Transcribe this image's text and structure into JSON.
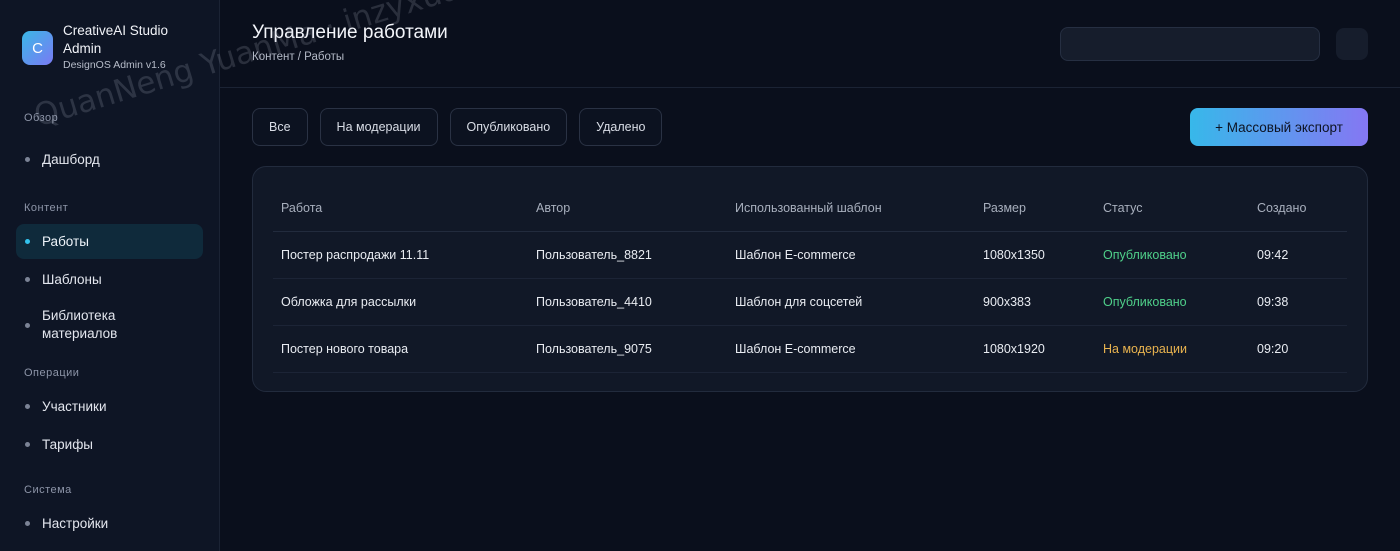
{
  "brand": {
    "logo_letter": "C",
    "name": "CreativeAI Studio Admin",
    "version": "DesignOS Admin v1.6"
  },
  "sidebar": {
    "sections": [
      {
        "title": "Обзор",
        "items": [
          {
            "label": "Дашборд",
            "active": false
          }
        ]
      },
      {
        "title": "Контент",
        "items": [
          {
            "label": "Работы",
            "active": true
          },
          {
            "label": "Шаблоны",
            "active": false
          },
          {
            "label": "Библиотека материалов",
            "active": false
          }
        ]
      },
      {
        "title": "Операции",
        "items": [
          {
            "label": "Участники",
            "active": false
          },
          {
            "label": "Тарифы",
            "active": false
          }
        ]
      },
      {
        "title": "Система",
        "items": [
          {
            "label": "Настройки",
            "active": false
          }
        ]
      }
    ]
  },
  "header": {
    "title": "Управление работами",
    "breadcrumb": "Контент / Работы",
    "search_value": "",
    "search_placeholder": ""
  },
  "filters": [
    "Все",
    "На модерации",
    "Опубликовано",
    "Удалено"
  ],
  "actions": {
    "export_label": "+ Массовый экспорт"
  },
  "table": {
    "columns": [
      "Работа",
      "Автор",
      "Использованный шаблон",
      "Размер",
      "Статус",
      "Создано"
    ],
    "rows": [
      {
        "work": "Постер распродажи 11.11",
        "author": "Пользователь_8821",
        "template": "Шаблон E-commerce",
        "size": "1080x1350",
        "status": "Опубликовано",
        "status_kind": "published",
        "created": "09:42"
      },
      {
        "work": "Обложка для рассылки",
        "author": "Пользователь_4410",
        "template": "Шаблон для соцсетей",
        "size": "900x383",
        "status": "Опубликовано",
        "status_kind": "published",
        "created": "09:38"
      },
      {
        "work": "Постер нового товара",
        "author": "Пользователь_9075",
        "template": "Шаблон E-commerce",
        "size": "1080x1920",
        "status": "На модерации",
        "status_kind": "moderation",
        "created": "09:20"
      }
    ]
  },
  "colors": {
    "accent": "#33c3ee",
    "published": "#4fd08a",
    "moderation": "#e9b34f"
  },
  "watermark": "QuanNeng YuanMa · inzyxuashop.com"
}
